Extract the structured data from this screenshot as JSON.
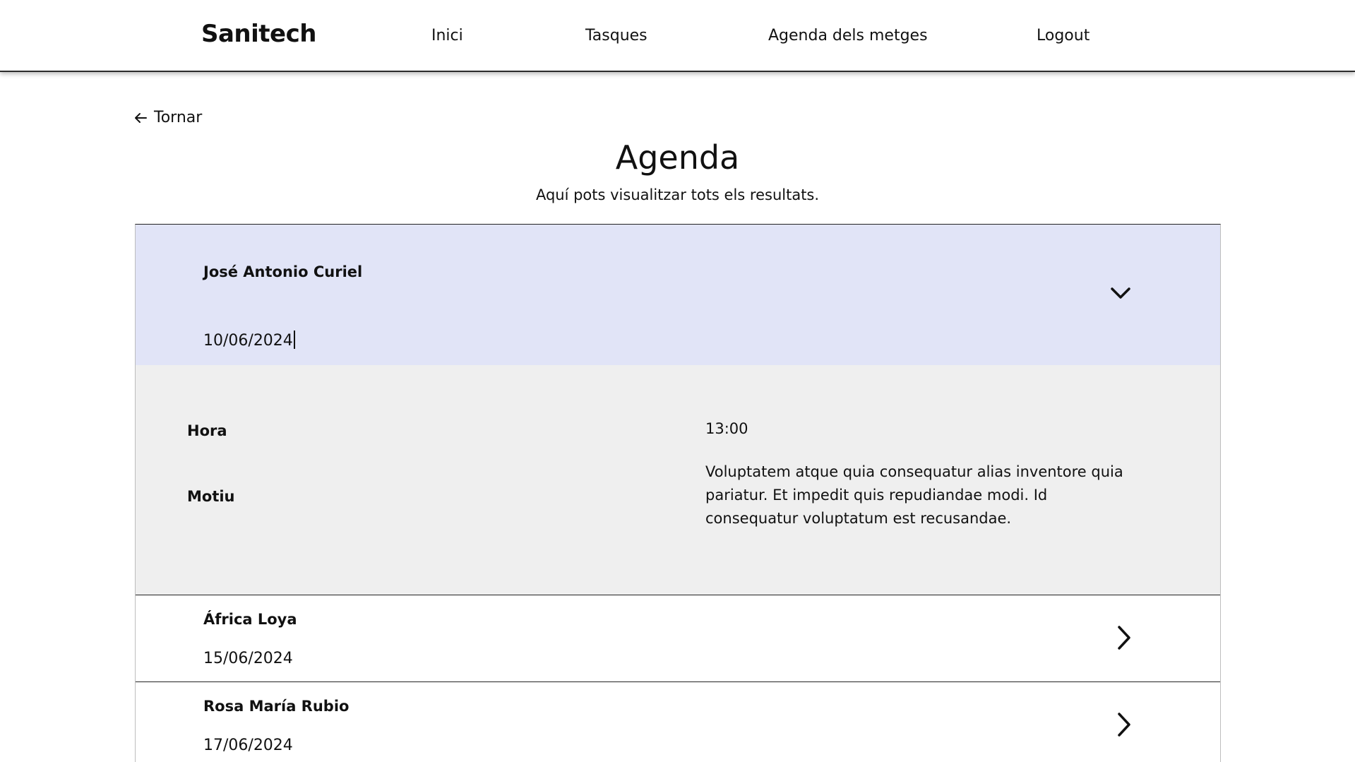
{
  "nav": {
    "brand": "Sanitech",
    "links": [
      "Inici",
      "Tasques",
      "Agenda dels metges",
      "Logout"
    ]
  },
  "back_label": "Tornar",
  "page_title": "Agenda",
  "page_subtitle": "Aquí pots visualitzar tots els resultats.",
  "appointments": [
    {
      "name": "José Antonio Curiel",
      "date": "10/06/2024",
      "expanded": true,
      "hora_label": "Hora",
      "hora": "13:00",
      "motiu_label": "Motiu",
      "motiu": "Voluptatem atque quia consequatur alias inventore quia pariatur. Et impedit quis repudiandae modi. Id consequatur voluptatum est recusandae."
    },
    {
      "name": "África Loya",
      "date": "15/06/2024",
      "expanded": false
    },
    {
      "name": "Rosa María Rubio",
      "date": "17/06/2024",
      "expanded": false
    }
  ],
  "icons": {
    "back": "arrow-left-icon",
    "expanded": "chevron-down-icon",
    "collapsed": "chevron-right-icon"
  },
  "colors": {
    "expanded_header": "#e1e4f7",
    "details_bg": "#efefef"
  }
}
